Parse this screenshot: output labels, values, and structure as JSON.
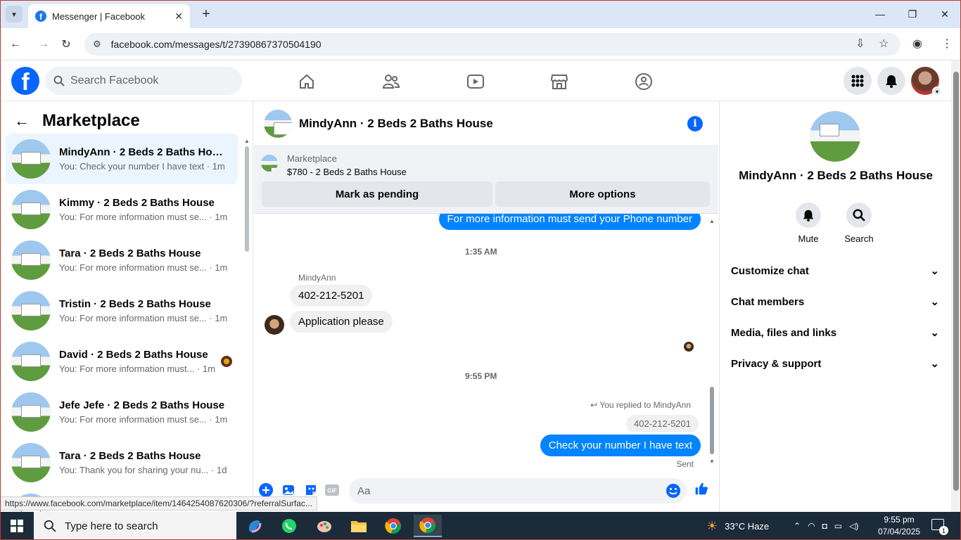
{
  "browser": {
    "tab_title": "Messenger | Facebook",
    "url": "facebook.com/messages/t/27390867370504190",
    "status_url": "https://www.facebook.com/marketplace/item/1464254087620306/?referralSurfac..."
  },
  "fb": {
    "search_placeholder": "Search Facebook"
  },
  "sidebar": {
    "title": "Marketplace",
    "conversations": [
      {
        "name": "MindyAnn · 2 Beds 2 Baths House",
        "snippet": "You: Check your number I have text · 1m"
      },
      {
        "name": "Kimmy · 2 Beds 2 Baths House",
        "snippet": "You: For more information must se... · 1m"
      },
      {
        "name": "Tara · 2 Beds 2 Baths House",
        "snippet": "You: For more information must se... · 1m"
      },
      {
        "name": "Tristin · 2 Beds 2 Baths House",
        "snippet": "You: For more information must se... · 1m"
      },
      {
        "name": "David · 2 Beds 2 Baths House",
        "snippet": "You: For more information must... · 1m"
      },
      {
        "name": "Jefe Jefe · 2 Beds 2 Baths House",
        "snippet": "You: For more information must se... · 1m"
      },
      {
        "name": "Tara · 2 Beds 2 Baths House",
        "snippet": "You: Thank you for sharing your nu... · 1d"
      }
    ]
  },
  "chat": {
    "title": "MindyAnn · 2 Beds 2 Baths House",
    "marketplace_label": "Marketplace",
    "listing_price": "$780 - 2 Beds 2 Baths House",
    "mark_pending": "Mark as pending",
    "more_options": "More options",
    "msg_out_1": "For more information must send your Phone number",
    "time_1": "1:35 AM",
    "sender_name": "MindyAnn",
    "msg_in_1": "402-212-5201",
    "msg_in_2": "Application please",
    "time_2": "9:55 PM",
    "reply_note": "You replied to MindyAnn",
    "quoted": "402-212-5201",
    "msg_out_2": "Check your number I have text",
    "sent_status": "Sent",
    "composer_placeholder": "Aa"
  },
  "details": {
    "name": "MindyAnn · 2 Beds 2 Baths House",
    "mute": "Mute",
    "search": "Search",
    "sections": [
      "Customize chat",
      "Chat members",
      "Media, files and links",
      "Privacy & support"
    ]
  },
  "taskbar": {
    "search_placeholder": "Type here to search",
    "weather": "33°C  Haze",
    "time": "9:55 pm",
    "date": "07/04/2025",
    "notif_count": "1"
  },
  "colors": {
    "fb_blue": "#0866ff",
    "bubble_blue": "#0084ff",
    "active_row": "#ebf5ff"
  }
}
